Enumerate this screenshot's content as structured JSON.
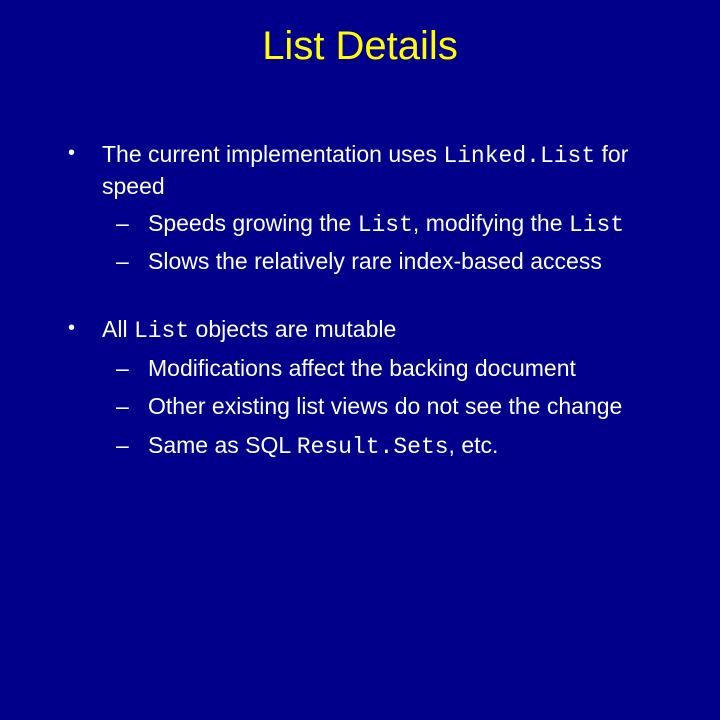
{
  "title": "List Details",
  "bullets": [
    {
      "line_pre1": "The current implementation uses ",
      "code1": "Linked.List",
      "line_post1": " for speed",
      "subs": [
        {
          "pre": "Speeds growing the ",
          "code1": "List",
          "mid": ", modifying the ",
          "code2": "List",
          "post": ""
        },
        {
          "pre": "Slows the relatively rare index-based access",
          "code1": "",
          "mid": "",
          "code2": "",
          "post": ""
        }
      ]
    },
    {
      "line_pre1": "All ",
      "code1": "List",
      "line_post1": " objects are mutable",
      "subs": [
        {
          "pre": "Modifications affect the backing document",
          "code1": "",
          "mid": "",
          "code2": "",
          "post": ""
        },
        {
          "pre": "Other existing list views do not see the change",
          "code1": "",
          "mid": "",
          "code2": "",
          "post": ""
        },
        {
          "pre": "Same as SQL ",
          "code1": "Result.Sets",
          "mid": ", etc.",
          "code2": "",
          "post": ""
        }
      ]
    }
  ]
}
